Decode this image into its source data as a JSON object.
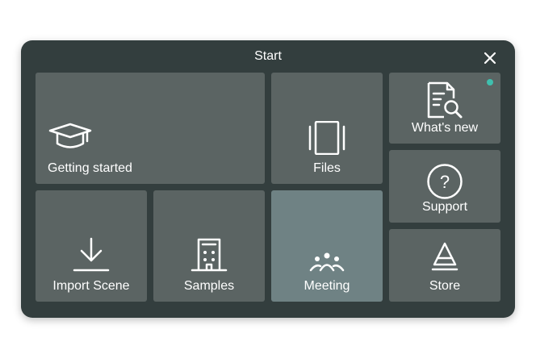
{
  "dialog": {
    "title": "Start"
  },
  "tiles": {
    "getting_started": {
      "label": "Getting started",
      "icon": "graduation-cap-icon"
    },
    "files": {
      "label": "Files",
      "icon": "files-carousel-icon"
    },
    "whats_new": {
      "label": "What's new",
      "icon": "document-search-icon",
      "has_notification": true
    },
    "import_scene": {
      "label": "Import Scene",
      "icon": "download-icon"
    },
    "samples": {
      "label": "Samples",
      "icon": "building-icon"
    },
    "meeting": {
      "label": "Meeting",
      "icon": "people-group-icon",
      "selected": true
    },
    "support": {
      "label": "Support",
      "icon": "question-circle-icon"
    },
    "store": {
      "label": "Store",
      "icon": "store-triangle-icon"
    }
  },
  "colors": {
    "dialog_bg": "#333e3e",
    "tile_bg": "#5b6463",
    "tile_selected_bg": "#6f8284",
    "notification_dot": "#3fbfae"
  }
}
